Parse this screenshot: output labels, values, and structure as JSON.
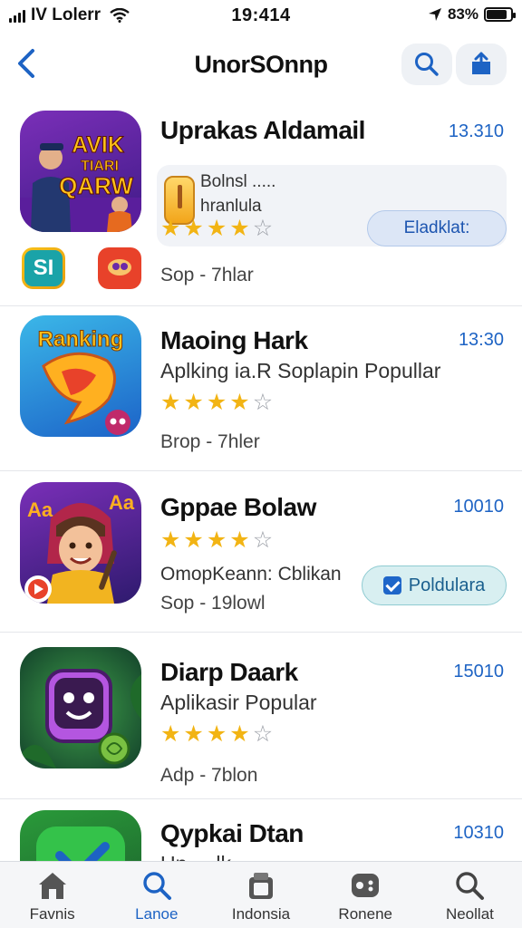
{
  "status": {
    "carrier": "IV Lolerr",
    "time": "19:414",
    "battery": "83%",
    "battery_level": 0.83
  },
  "nav": {
    "title": "UnorSOnnp"
  },
  "apps": [
    {
      "name": "Uprakas Aldamail",
      "price": "13.310",
      "promo_line1": "Bolnsl .....",
      "promo_line2": "hranlula",
      "action": "Eladklat:",
      "meta": "Sop - 7hlar",
      "rating": 4
    },
    {
      "name": "Maoing Hark",
      "price": "13:30",
      "subtitle": "Aplking ia.R Soplapin Popullar",
      "meta": "Brop - 7hler",
      "rating": 4,
      "icon_text": "Ranking"
    },
    {
      "name": "Gppae Bolaw",
      "price": "10010",
      "subtitle": "OmopKeann: Cblikan",
      "meta": "Sop - 19lowl",
      "action": "Poldulara",
      "rating": 4,
      "icon_text_left": "Aa",
      "icon_text_right": "Aa"
    },
    {
      "name": "Diarp Daark",
      "price": "15010",
      "subtitle": "Aplikasir Popular",
      "meta": "Adp - 7blon",
      "rating": 4
    },
    {
      "name": "Qypkai Dtan",
      "price": "10310",
      "subtitle": "Un ... lk"
    }
  ],
  "icon1_text": [
    "AVIK",
    "TIARI",
    "QARW"
  ],
  "mini_icon_text": "SI",
  "tabs": [
    {
      "label": "Favnis",
      "icon": "home-icon"
    },
    {
      "label": "Lanoe",
      "icon": "search-icon",
      "active": true
    },
    {
      "label": "Indonsia",
      "icon": "apps-icon"
    },
    {
      "label": "Ronene",
      "icon": "games-icon"
    },
    {
      "label": "Neollat",
      "icon": "search-icon"
    }
  ],
  "colors": {
    "accent": "#1d63c4",
    "star": "#f2b414"
  }
}
